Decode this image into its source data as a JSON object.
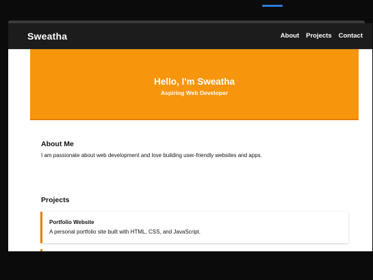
{
  "brand": "Sweatha",
  "nav": {
    "items": [
      {
        "label": "About"
      },
      {
        "label": "Projects"
      },
      {
        "label": "Contact"
      }
    ]
  },
  "hero": {
    "title": "Hello, I'm Sweatha",
    "subtitle": "Aspiring Web Developer"
  },
  "about": {
    "heading": "About Me",
    "text": "I am passionate about web development and love building user-friendly websites and apps."
  },
  "projects": {
    "heading": "Projects",
    "items": [
      {
        "title": "Portfolio Website",
        "description": "A personal portfolio site built with HTML, CSS, and JavaScript."
      }
    ]
  },
  "colors": {
    "hero_background": "#f7950c",
    "navbar_background": "#1c1c1c",
    "accent": "#e57e00"
  }
}
